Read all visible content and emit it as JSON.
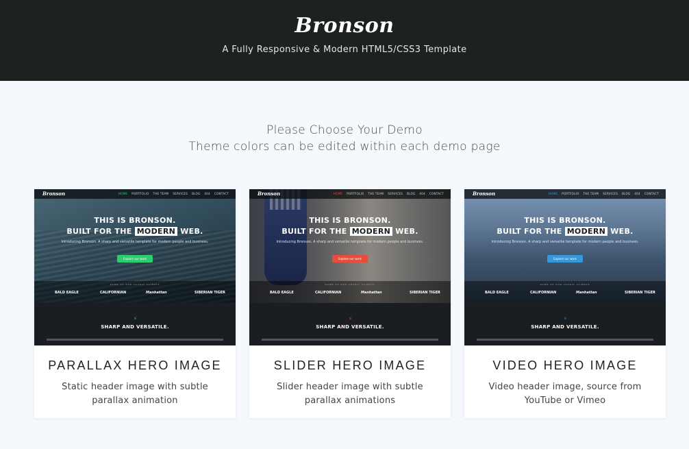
{
  "header": {
    "brand": "Bronson",
    "tagline": "A Fully Responsive & Modern HTML5/CSS3 Template"
  },
  "intro": {
    "line1": "Please Choose Your Demo",
    "line2": "Theme colors can be edited within each demo page"
  },
  "preview": {
    "brand": "Bronson",
    "nav": [
      "HOME",
      "PORTFOLIO",
      "THE TEAM",
      "SERVICES",
      "BLOG",
      "404",
      "CONTACT"
    ],
    "hero_line1": "THIS IS BRONSON.",
    "hero_line2_pre": "BUILT FOR THE",
    "hero_line2_hl": "MODERN",
    "hero_line2_post": "WEB.",
    "hero_sub": "Introducing Bronson. A sharp and versatile template for modern people and business.",
    "button": "Explore our work",
    "clients_title": "SOME OF OUR LOVELY CLIENTS",
    "clients": [
      "BALD EAGLE",
      "CALIFORNIAN",
      "Manhattan",
      "SIBERIAN TIGER"
    ],
    "sharp": "SHARP AND VERSATILE."
  },
  "demos": [
    {
      "title": "PARALLAX HERO IMAGE",
      "description": "Static header image with subtle parallax animation",
      "accent": "#2ecc71"
    },
    {
      "title": "SLIDER HERO IMAGE",
      "description": "Slider header image with subtle parallax animations",
      "accent": "#e74c3c"
    },
    {
      "title": "VIDEO HERO IMAGE",
      "description": "Video header image, source from YouTube or Vimeo",
      "accent": "#3498db"
    }
  ]
}
